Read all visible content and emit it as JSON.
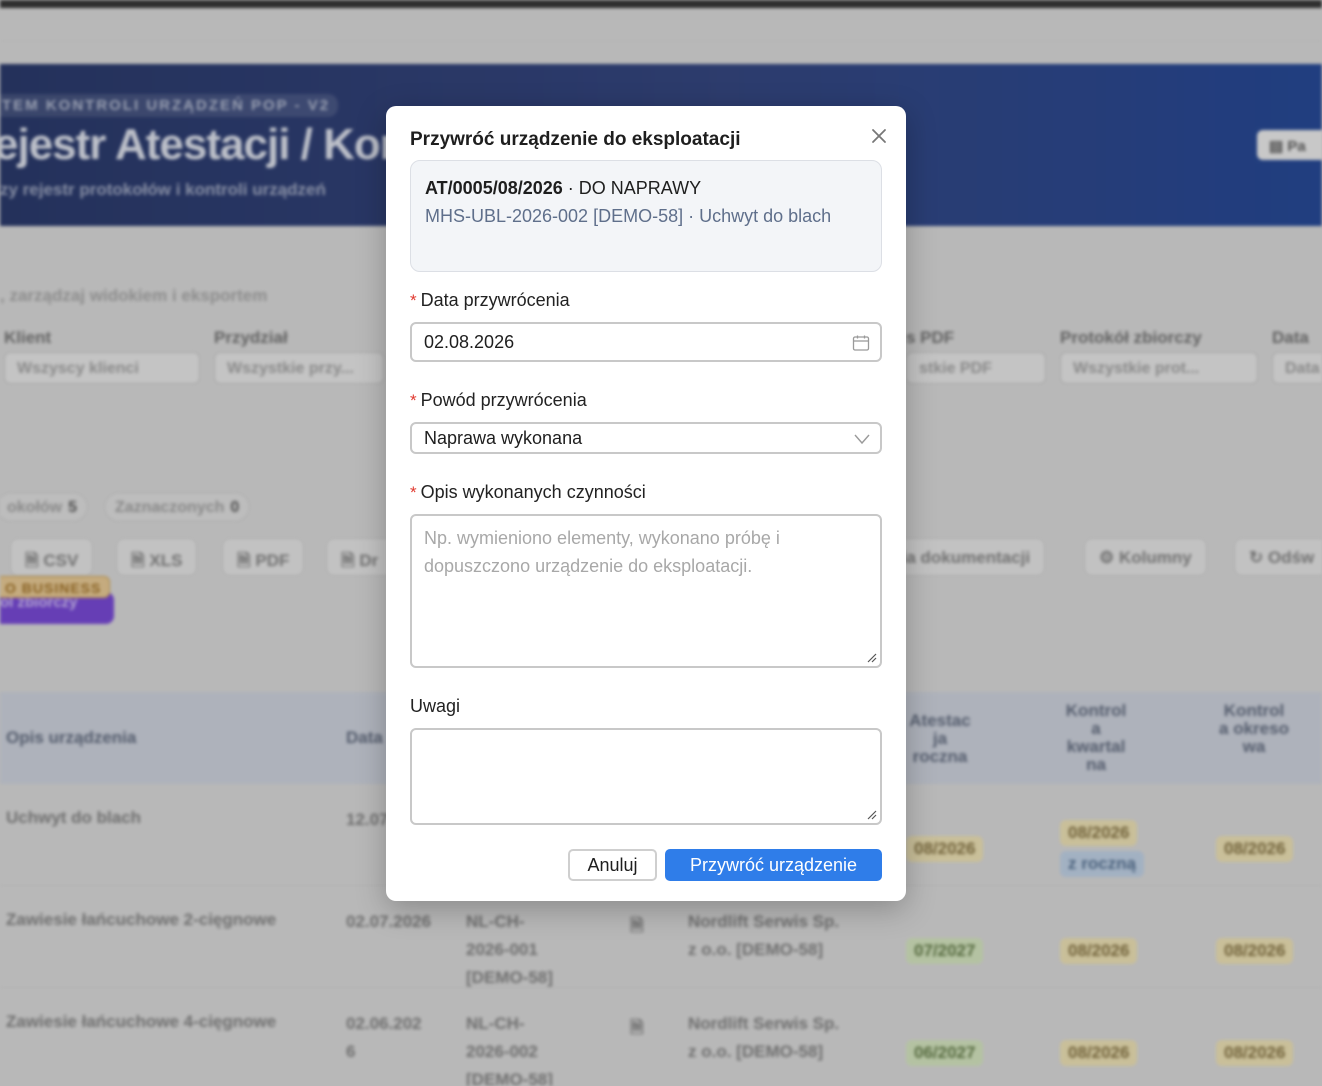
{
  "background": {
    "hero": {
      "kicker": "TEM KONTROLI URZĄDZEŃ POP - V2",
      "title": "ejestr Atestacji / Kont",
      "subtitle": "zy rejestr protokołów i kontroli urządzeń",
      "side_button": "Pa"
    },
    "filters_hint": ", zarządzaj widokiem i eksportem",
    "filters": [
      {
        "label": "Klient",
        "value": "Wszyscy klienci"
      },
      {
        "label": "Przydział",
        "value": "Wszystkie przy..."
      },
      {
        "label": "s PDF",
        "value": "stkie PDF"
      },
      {
        "label": "Protokół zbiorczy",
        "value": "Wszystkie prot..."
      },
      {
        "label": "Data",
        "value": "Data"
      }
    ],
    "counters": [
      {
        "label": "okołów",
        "value": "5"
      },
      {
        "label": "Zaznaczonych",
        "value": "0"
      }
    ],
    "toolbar": [
      "CSV",
      "XLS",
      "PDF",
      "Dr",
      "ria dokumentacji",
      "Kolumny",
      "Odśw"
    ],
    "business_badge": "O BUSINESS",
    "purple_button": "ol zbiorczy",
    "table_headers": [
      "Opis urządzenia",
      "Data",
      "Atestac ja roczna",
      "Kontrol a kwartal na",
      "Kontrol a okreso wa"
    ],
    "rows": [
      {
        "desc": "Uchwyt do blach",
        "date": "12.07",
        "protocol": "",
        "company": "",
        "atest": "08/2026",
        "kwart": "08/2026",
        "kwart_note": "z roczną",
        "okres": "08/2026"
      },
      {
        "desc": "Zawiesie łańcuchowe 2-cięgnowe",
        "date": "02.07.2026",
        "protocol": "NL-CH-\n2026-001\n[DEMO-58]",
        "company": "Nordlift Serwis Sp.\nz o.o. [DEMO-58]",
        "atest": "07/2027",
        "kwart": "08/2026",
        "kwart_note": "",
        "okres": "08/2026"
      },
      {
        "desc": "Zawiesie łańcuchowe 4-cięgnowe",
        "date": "02.06.202\n6",
        "protocol": "NL-CH-\n2026-002\n[DEMO-58]",
        "company": "Nordlift Serwis Sp.\nz o.o. [DEMO-58]",
        "atest": "06/2027",
        "kwart": "08/2026",
        "kwart_note": "",
        "okres": "08/2026"
      }
    ]
  },
  "modal": {
    "title": "Przywróć urządzenie do eksploatacji",
    "protocol_number": "AT/0005/08/2026",
    "status": "· DO NAPRAWY",
    "device_line": "MHS-UBL-2026-002 [DEMO-58] · Uchwyt do blach",
    "date_label": "Data przywrócenia",
    "date_value": "02.08.2026",
    "reason_label": "Powód przywrócenia",
    "reason_value": "Naprawa wykonana",
    "description_label": "Opis wykonanych czynności",
    "description_placeholder": "Np. wymieniono elementy, wykonano próbę i dopuszczono urządzenie do eksploatacji.",
    "notes_label": "Uwagi",
    "notes_value": "",
    "cancel_label": "Anuluj",
    "submit_label": "Przywróć urządzenie",
    "required_marker": "*"
  },
  "colors": {
    "primary": "#2f7de9",
    "required": "#e0392f",
    "hero": "#1f2f62"
  }
}
